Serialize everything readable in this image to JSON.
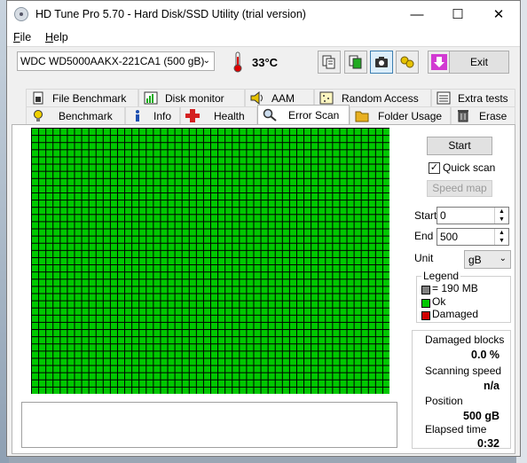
{
  "window": {
    "title": "HD Tune Pro 5.70 - Hard Disk/SSD Utility (trial version)"
  },
  "menu": {
    "file": "File",
    "help": "Help"
  },
  "toolbar": {
    "drive": "WDC WD5000AAKX-221CA1 (500 gB)",
    "temperature": "33°C",
    "exit_label": "Exit"
  },
  "tabs_top": [
    "File Benchmark",
    "Disk monitor",
    "AAM",
    "Random Access",
    "Extra tests"
  ],
  "tabs_bottom": [
    "Benchmark",
    "Info",
    "Health",
    "Error Scan",
    "Folder Usage",
    "Erase"
  ],
  "selected_tab": "Error Scan",
  "scan": {
    "start_label": "Start",
    "quick_scan_label": "Quick scan",
    "quick_scan_checked": true,
    "speed_map_label": "Speed map",
    "start_field_label": "Start",
    "start_value": "0",
    "end_field_label": "End",
    "end_value": "500",
    "unit_label": "Unit",
    "unit_value": "gB",
    "grid_cols": 50,
    "grid_rows": 37,
    "block_color": "#00c800"
  },
  "legend": {
    "title": "Legend",
    "block_size": "= 190 MB",
    "ok": "Ok",
    "damaged": "Damaged",
    "colors": {
      "block": "#808080",
      "ok": "#00c800",
      "damaged": "#d00000"
    }
  },
  "stats": {
    "damaged_blocks_label": "Damaged blocks",
    "damaged_blocks_value": "0.0 %",
    "scanning_speed_label": "Scanning speed",
    "scanning_speed_value": "n/a",
    "position_label": "Position",
    "position_value": "500 gB",
    "elapsed_label": "Elapsed time",
    "elapsed_value": "0:32"
  }
}
